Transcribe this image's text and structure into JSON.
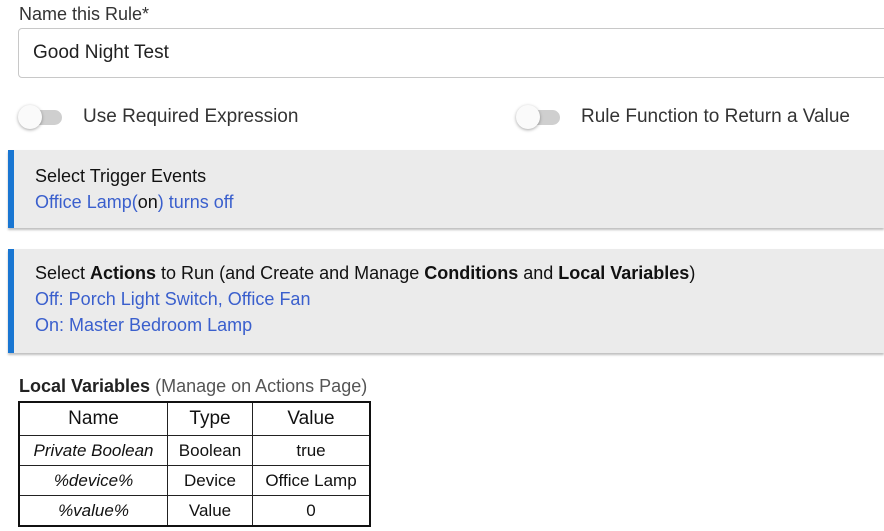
{
  "rule_name": {
    "label": "Name this Rule*",
    "value": "Good Night Test"
  },
  "toggles": [
    {
      "label": "Use Required Expression",
      "checked": false
    },
    {
      "label": "Rule Function to Return a Value",
      "checked": false
    }
  ],
  "trigger_section": {
    "title": "Select Trigger Events",
    "line": {
      "device": "Office Lamp",
      "open_paren": "(",
      "state": "on",
      "rest": ") turns off"
    }
  },
  "actions_section": {
    "title_parts": {
      "p1": "Select ",
      "b1": "Actions",
      "p2": " to Run (and Create and Manage ",
      "b2": "Conditions",
      "p3": " and ",
      "b3": "Local Variables",
      "p4": ")"
    },
    "lines": [
      "Off: Porch Light Switch, Office Fan",
      "On: Master Bedroom Lamp"
    ]
  },
  "local_variables": {
    "label_bold": "Local Variables",
    "label_rest": " (Manage on Actions Page)",
    "headers": [
      "Name",
      "Type",
      "Value"
    ],
    "rows": [
      {
        "name": "Private Boolean",
        "type": "Boolean",
        "value": "true"
      },
      {
        "name": "%device%",
        "type": "Device",
        "value": "Office Lamp"
      },
      {
        "name": "%value%",
        "type": "Value",
        "value": "0"
      }
    ]
  },
  "colors": {
    "accent": "#1976d2",
    "link": "#3a5fcd",
    "section_bg": "#ebebeb"
  }
}
